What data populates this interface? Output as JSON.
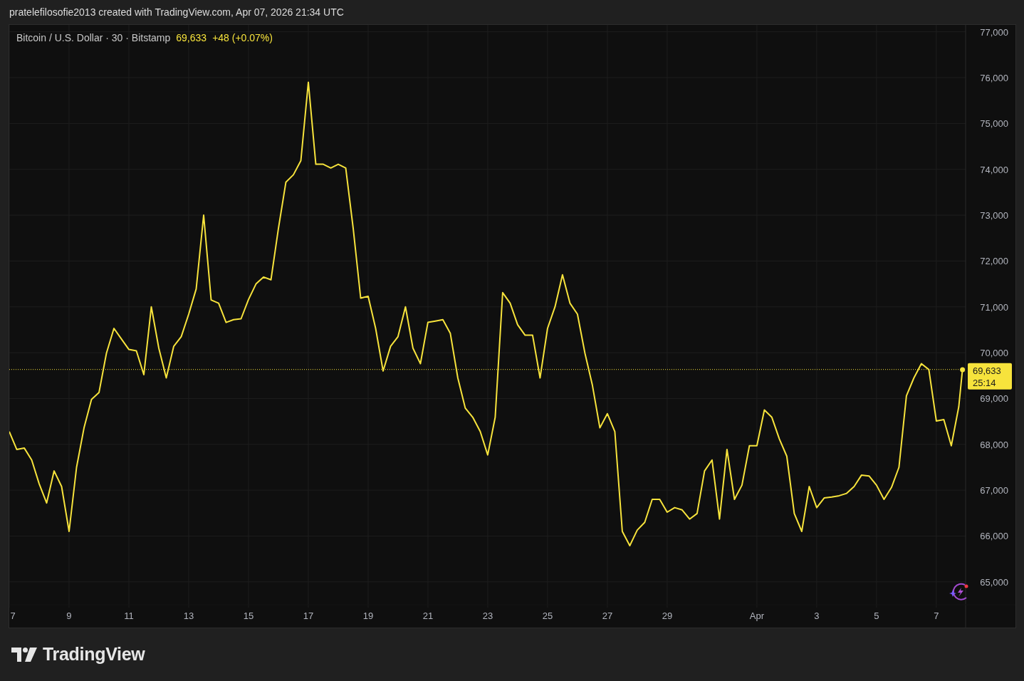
{
  "header": {
    "attribution": "pratelefilosofie2013 created with TradingView.com, Apr 07, 2026 21:34 UTC"
  },
  "legend": {
    "symbol": "Bitcoin / U.S. Dollar · 30 · Bitstamp",
    "price": "69,633",
    "change": "+48 (+0.07%)"
  },
  "last_price_label": {
    "countdown": "25:14"
  },
  "chart_data": {
    "type": "line",
    "x": [
      "2026-03-07T00:00",
      "2026-03-07T06:00",
      "2026-03-07T12:00",
      "2026-03-07T18:00",
      "2026-03-08T00:00",
      "2026-03-08T06:00",
      "2026-03-08T12:00",
      "2026-03-08T18:00",
      "2026-03-09T00:00",
      "2026-03-09T06:00",
      "2026-03-09T12:00",
      "2026-03-09T18:00",
      "2026-03-10T00:00",
      "2026-03-10T06:00",
      "2026-03-10T12:00",
      "2026-03-10T18:00",
      "2026-03-11T00:00",
      "2026-03-11T06:00",
      "2026-03-11T12:00",
      "2026-03-11T18:00",
      "2026-03-12T00:00",
      "2026-03-12T06:00",
      "2026-03-12T12:00",
      "2026-03-12T18:00",
      "2026-03-13T00:00",
      "2026-03-13T06:00",
      "2026-03-13T12:00",
      "2026-03-13T18:00",
      "2026-03-14T00:00",
      "2026-03-14T06:00",
      "2026-03-14T12:00",
      "2026-03-14T18:00",
      "2026-03-15T00:00",
      "2026-03-15T06:00",
      "2026-03-15T12:00",
      "2026-03-15T18:00",
      "2026-03-16T00:00",
      "2026-03-16T06:00",
      "2026-03-16T12:00",
      "2026-03-16T18:00",
      "2026-03-17T00:00",
      "2026-03-17T06:00",
      "2026-03-17T12:00",
      "2026-03-17T18:00",
      "2026-03-18T00:00",
      "2026-03-18T06:00",
      "2026-03-18T12:00",
      "2026-03-18T18:00",
      "2026-03-19T00:00",
      "2026-03-19T06:00",
      "2026-03-19T12:00",
      "2026-03-19T18:00",
      "2026-03-20T00:00",
      "2026-03-20T06:00",
      "2026-03-20T12:00",
      "2026-03-20T18:00",
      "2026-03-21T00:00",
      "2026-03-21T06:00",
      "2026-03-21T12:00",
      "2026-03-21T18:00",
      "2026-03-22T00:00",
      "2026-03-22T06:00",
      "2026-03-22T12:00",
      "2026-03-22T18:00",
      "2026-03-23T00:00",
      "2026-03-23T06:00",
      "2026-03-23T12:00",
      "2026-03-23T18:00",
      "2026-03-24T00:00",
      "2026-03-24T06:00",
      "2026-03-24T12:00",
      "2026-03-24T18:00",
      "2026-03-25T00:00",
      "2026-03-25T06:00",
      "2026-03-25T12:00",
      "2026-03-25T18:00",
      "2026-03-26T00:00",
      "2026-03-26T06:00",
      "2026-03-26T12:00",
      "2026-03-26T18:00",
      "2026-03-27T00:00",
      "2026-03-27T06:00",
      "2026-03-27T12:00",
      "2026-03-27T18:00",
      "2026-03-28T00:00",
      "2026-03-28T06:00",
      "2026-03-28T12:00",
      "2026-03-28T18:00",
      "2026-03-29T00:00",
      "2026-03-29T06:00",
      "2026-03-29T12:00",
      "2026-03-29T18:00",
      "2026-03-30T00:00",
      "2026-03-30T06:00",
      "2026-03-30T12:00",
      "2026-03-30T18:00",
      "2026-03-31T00:00",
      "2026-03-31T06:00",
      "2026-03-31T12:00",
      "2026-03-31T18:00",
      "2026-04-01T00:00",
      "2026-04-01T06:00",
      "2026-04-01T12:00",
      "2026-04-01T18:00",
      "2026-04-02T00:00",
      "2026-04-02T06:00",
      "2026-04-02T12:00",
      "2026-04-02T18:00",
      "2026-04-03T00:00",
      "2026-04-03T06:00",
      "2026-04-03T12:00",
      "2026-04-03T18:00",
      "2026-04-04T00:00",
      "2026-04-04T06:00",
      "2026-04-04T12:00",
      "2026-04-04T18:00",
      "2026-04-05T00:00",
      "2026-04-05T06:00",
      "2026-04-05T12:00",
      "2026-04-05T18:00",
      "2026-04-06T00:00",
      "2026-04-06T06:00",
      "2026-04-06T12:00",
      "2026-04-06T18:00",
      "2026-04-07T00:00",
      "2026-04-07T06:00",
      "2026-04-07T12:00",
      "2026-04-07T18:00",
      "2026-04-07T21:00"
    ],
    "series": [
      {
        "color": "#f7e33c",
        "values": [
          68280,
          67890,
          67920,
          67660,
          67140,
          66720,
          67420,
          67080,
          66100,
          67500,
          68360,
          68980,
          69130,
          69990,
          70530,
          70300,
          70070,
          70040,
          69520,
          71000,
          70100,
          69450,
          70140,
          70350,
          70840,
          71390,
          73000,
          71150,
          71080,
          70660,
          70720,
          70740,
          71160,
          71500,
          71650,
          71590,
          72710,
          73720,
          73880,
          74190,
          75900,
          74110,
          74110,
          74030,
          74110,
          74030,
          72710,
          71190,
          71230,
          70530,
          69600,
          70140,
          70350,
          71000,
          70100,
          69760,
          70660,
          70690,
          70720,
          70420,
          69450,
          68790,
          68590,
          68280,
          67770,
          68590,
          71310,
          71080,
          70610,
          70380,
          70380,
          69450,
          70530,
          71000,
          71700,
          71080,
          70840,
          69990,
          69290,
          68360,
          68670,
          68280,
          66100,
          65790,
          66130,
          66300,
          66800,
          66800,
          66520,
          66620,
          66570,
          66370,
          66490,
          67420,
          67660,
          66370,
          67890,
          66800,
          67110,
          67970,
          67970,
          68750,
          68590,
          68120,
          67740,
          66490,
          66100,
          67080,
          66620,
          66830,
          66850,
          66880,
          66930,
          67080,
          67330,
          67310,
          67110,
          66800,
          67060,
          67500,
          69060,
          69450,
          69760,
          69630,
          68510,
          68540,
          67970,
          68820,
          69630
        ]
      }
    ],
    "ref_lines": [
      {
        "axis": "y",
        "value": 69633,
        "label": "69,633",
        "color": "#f7e33c"
      }
    ],
    "grid": true,
    "xlim": [
      "2026-03-07T00:00",
      "2026-04-07T23:30"
    ],
    "ylim": [
      64500,
      77150
    ],
    "xticks": [
      {
        "value": "2026-03-07T00:00",
        "label": "7"
      },
      {
        "value": "2026-03-09T00:00",
        "label": "9"
      },
      {
        "value": "2026-03-11T00:00",
        "label": "11"
      },
      {
        "value": "2026-03-13T00:00",
        "label": "13"
      },
      {
        "value": "2026-03-15T00:00",
        "label": "15"
      },
      {
        "value": "2026-03-17T00:00",
        "label": "17"
      },
      {
        "value": "2026-03-19T00:00",
        "label": "19"
      },
      {
        "value": "2026-03-21T00:00",
        "label": "21"
      },
      {
        "value": "2026-03-23T00:00",
        "label": "23"
      },
      {
        "value": "2026-03-25T00:00",
        "label": "25"
      },
      {
        "value": "2026-03-27T00:00",
        "label": "27"
      },
      {
        "value": "2026-03-29T00:00",
        "label": "29"
      },
      {
        "value": "2026-04-01T00:00",
        "label": "Apr"
      },
      {
        "value": "2026-04-03T00:00",
        "label": "3"
      },
      {
        "value": "2026-04-05T00:00",
        "label": "5"
      },
      {
        "value": "2026-04-07T00:00",
        "label": "7"
      }
    ],
    "yticks": [
      {
        "value": 65000,
        "label": "65,000"
      },
      {
        "value": 66000,
        "label": "66,000"
      },
      {
        "value": 67000,
        "label": "67,000"
      },
      {
        "value": 68000,
        "label": "68,000"
      },
      {
        "value": 69000,
        "label": "69,000"
      },
      {
        "value": 70000,
        "label": "70,000"
      },
      {
        "value": 71000,
        "label": "71,000"
      },
      {
        "value": 72000,
        "label": "72,000"
      },
      {
        "value": 73000,
        "label": "73,000"
      },
      {
        "value": 74000,
        "label": "74,000"
      },
      {
        "value": 75000,
        "label": "75,000"
      },
      {
        "value": 76000,
        "label": "76,000"
      },
      {
        "value": 77000,
        "label": "77,000"
      }
    ]
  },
  "footer": {
    "brand": "TradingView"
  }
}
